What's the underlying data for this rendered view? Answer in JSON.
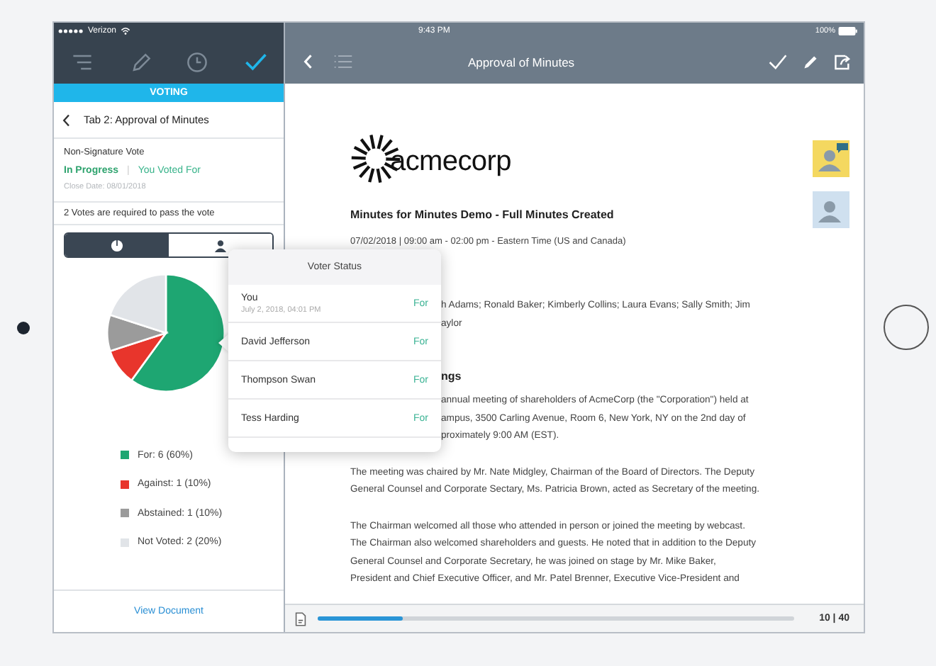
{
  "left": {
    "status_bar": {
      "carrier": "Verizon"
    },
    "toolbar": [
      {
        "kind": "list",
        "selected": false
      },
      {
        "kind": "pencil",
        "selected": false
      },
      {
        "kind": "clock",
        "selected": false
      },
      {
        "kind": "check",
        "selected": true
      }
    ],
    "band": "VOTING",
    "tab_title": "Tab 2: Approval of Minutes"
  },
  "voting": {
    "type": "Non-Signature Vote",
    "status": "In Progress",
    "separator": "|",
    "my_vote": "You Voted For",
    "close_date": "Close Date: 08/01/2018",
    "requirement": "2 Votes are required to pass the vote",
    "segments": [
      {
        "kind": "pie",
        "selected": true
      },
      {
        "kind": "person",
        "selected": false
      }
    ],
    "chart_data": {
      "type": "pie",
      "categories": [
        "For: 6 (60%)",
        "Against: 1 (10%)",
        "Abstained: 1 (10%)",
        "Not Voted: 2 (20%)"
      ],
      "values": [
        60,
        10,
        10,
        20
      ],
      "legend": "bottom"
    },
    "legend": [
      {
        "color": "#1ea672"
      },
      {
        "color": "#e8352c"
      },
      {
        "color": "#9b9b9b"
      },
      {
        "color": "#e1e4e8"
      }
    ],
    "link": "View Document"
  },
  "right": {
    "status_bar": {
      "time": "9:43 PM",
      "battery": "100%"
    },
    "title": "Approval of Minutes"
  },
  "document": {
    "logo": "acmecorp",
    "title": "Minutes for Minutes Demo - Full Minutes Created",
    "date": "07/02/2018 | 09:00 am - 02:00 pm - Eastern Time (US and Canada)",
    "covered_blocks": [
      {
        "kind": "text",
        "lines": [
          "h Adams; Ronald Baker; Kimberly Collins; Laura Evans; Sally Smith; Jim",
          "aylor"
        ]
      },
      {
        "kind": "heading",
        "lines": [
          "ngs"
        ]
      },
      {
        "kind": "text",
        "lines": [
          "annual meeting of shareholders of AcmeCorp (the \"Corporation\") held at",
          "ampus, 3500 Carling Avenue, Room 6, New York, NY on the 2nd day of",
          "proximately 9:00 AM (EST)."
        ]
      }
    ],
    "paragraphs": [
      [
        "The meeting was chaired by Mr. Nate Midgley, Chairman of the Board of Directors. The Deputy",
        "General Counsel and Corporate Sectary, Ms. Patricia Brown, acted as Secretary of the meeting."
      ],
      [
        "The Chairman welcomed all those who attended in person or joined the meeting by webcast.",
        "The Chairman also welcomed shareholders and guests. He noted that in addition to the Deputy",
        "General Counsel and Corporate Secretary, he was joined on stage by Mr. Mike Baker,",
        "President and Chief Executive Officer, and Mr. Patel Brenner, Executive Vice-President and"
      ]
    ],
    "comments": [
      {
        "kind": "note"
      },
      {
        "kind": "plain"
      }
    ]
  },
  "pager": {
    "level": 0.18,
    "page": "10 | 40"
  },
  "popover": {
    "title": "Voter Status",
    "rows": [
      {
        "name": "You",
        "date": "July 2, 2018, 04:01 PM",
        "vote": "For"
      },
      {
        "name": "David Jefferson",
        "vote": "For"
      },
      {
        "name": "Thompson Swan",
        "vote": "For"
      },
      {
        "name": "Tess Harding",
        "vote": "For"
      }
    ]
  }
}
